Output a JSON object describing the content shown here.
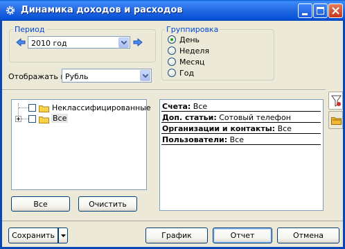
{
  "window": {
    "title": "Динамика доходов и расходов"
  },
  "period": {
    "label": "Период",
    "value": "2010 год"
  },
  "grouping": {
    "label": "Группировка",
    "options": [
      "День",
      "Неделя",
      "Месяц",
      "Год"
    ],
    "selected": "День"
  },
  "display": {
    "label": "Отображать в:",
    "value": "Рубль"
  },
  "tree": {
    "items": [
      "Неклассифицированные",
      "Все"
    ]
  },
  "tree_buttons": {
    "all": "Все",
    "clear": "Очистить"
  },
  "filters": [
    {
      "key": "Счета:",
      "value": "Все"
    },
    {
      "key": "Доп. статьи:",
      "value": "Сотовый телефон"
    },
    {
      "key": "Организации и контакты:",
      "value": "Все"
    },
    {
      "key": "Пользователи:",
      "value": "Все"
    }
  ],
  "footer": {
    "save": "Сохранить",
    "chart": "График",
    "report": "Отчет",
    "cancel": "Отмена"
  },
  "colors": {
    "titlebar": "#0853d8",
    "group_label": "#0046d5",
    "radio_selected": "#21a121"
  }
}
